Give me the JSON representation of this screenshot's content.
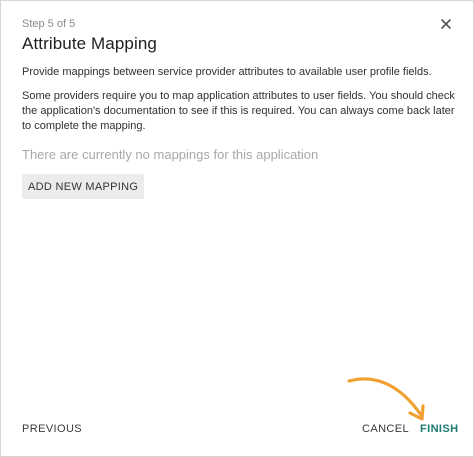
{
  "dialog": {
    "step": "Step 5 of 5",
    "title": "Attribute Mapping",
    "description": "Provide mappings between service provider attributes to available user profile fields.",
    "note": "Some providers require you to map application attributes to user fields. You should check the application's documentation to see if this is required. You can always come back later to complete the mapping.",
    "empty_state": "There are currently no mappings for this application",
    "add_button": "ADD NEW MAPPING"
  },
  "footer": {
    "previous": "PREVIOUS",
    "cancel": "CANCEL",
    "finish": "FINISH"
  },
  "icons": {
    "close": "close-icon",
    "annotation": "arrow-annotation-icon"
  },
  "colors": {
    "accent": "#1c7872",
    "annotation_arrow": "#f0a030"
  }
}
